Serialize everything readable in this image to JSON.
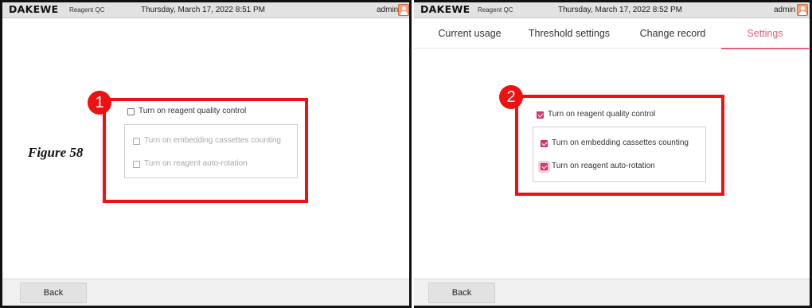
{
  "left_panel": {
    "brand": "DAKEWE",
    "app_name": "Reagent QC",
    "datetime": "Thursday, March 17, 2022 8:51 PM",
    "user": "admin",
    "marker": "1",
    "options": {
      "quality_control": {
        "label": "Turn on reagent quality control",
        "checked": false,
        "enabled": true
      },
      "cassettes_counting": {
        "label": "Turn on embedding cassettes counting",
        "checked": false,
        "enabled": false
      },
      "auto_rotation": {
        "label": "Turn on  reagent auto-rotation",
        "checked": false,
        "enabled": false
      }
    },
    "back_label": "Back"
  },
  "figure_caption": "Figure 58",
  "right_panel": {
    "brand": "DAKEWE",
    "app_name": "Reagent QC",
    "datetime": "Thursday, March 17, 2022 8:52 PM",
    "user": "admin",
    "tabs": [
      {
        "label": "Current usage",
        "active": false
      },
      {
        "label": "Threshold settings",
        "active": false
      },
      {
        "label": "Change record",
        "active": false
      },
      {
        "label": "Settings",
        "active": true
      }
    ],
    "marker": "2",
    "options": {
      "quality_control": {
        "label": "Turn on reagent quality control",
        "checked": true,
        "enabled": true
      },
      "cassettes_counting": {
        "label": "Turn on embedding cassettes counting",
        "checked": true,
        "enabled": true
      },
      "auto_rotation": {
        "label": "Turn on  reagent auto-rotation",
        "checked": true,
        "enabled": true
      }
    },
    "back_label": "Back"
  },
  "colors": {
    "accent": "#e06080",
    "checkbox_checked": "#d83a6a",
    "highlight_red": "#ee1111",
    "header_bg": "#e2e2e2"
  },
  "icons": {
    "avatar": "user-avatar-icon",
    "checkbox": "checkbox-icon"
  }
}
